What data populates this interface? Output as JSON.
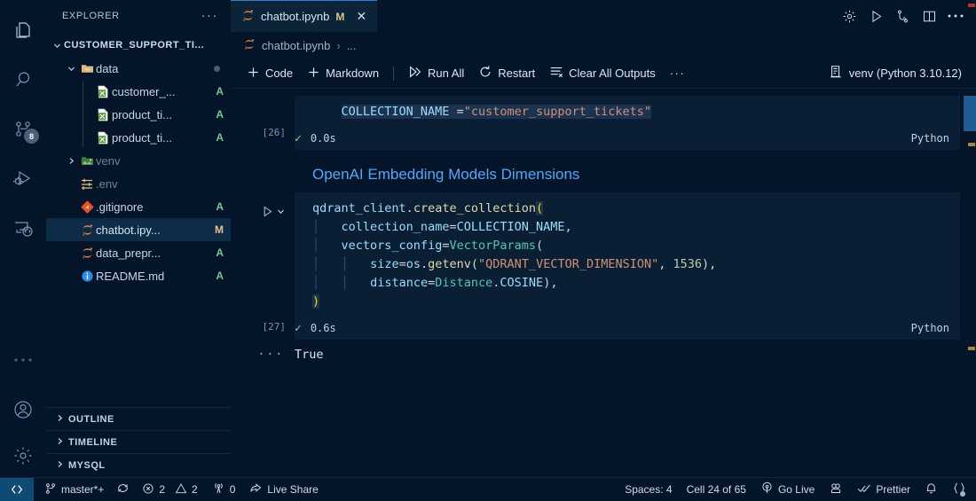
{
  "activitybar": {
    "items": [
      {
        "name": "explorer",
        "icon": "files-icon",
        "badge": null
      },
      {
        "name": "search",
        "icon": "search-icon",
        "badge": null
      },
      {
        "name": "source-control",
        "icon": "source-control-icon",
        "badge": "8"
      },
      {
        "name": "run-and-debug",
        "icon": "run-debug-icon",
        "badge": null
      },
      {
        "name": "remote-explorer",
        "icon": "remote-explorer-icon",
        "badge": null
      },
      {
        "name": "additional-views",
        "icon": "ellipsis-icon",
        "badge": null
      }
    ],
    "bottom": [
      {
        "name": "accounts",
        "icon": "account-icon"
      },
      {
        "name": "manage",
        "icon": "gear-icon"
      }
    ]
  },
  "sidebar": {
    "title": "EXPLORER",
    "more_label": "···",
    "root": "CUSTOMER_SUPPORT_TI...",
    "items": [
      {
        "label": "data",
        "icon": "folder-data-icon",
        "status": "",
        "indent": 1,
        "kind": "folder",
        "expanded": true,
        "modified_dot": true
      },
      {
        "label": "customer_...",
        "icon": "csv-file-icon",
        "status": "A",
        "indent": 2,
        "kind": "file"
      },
      {
        "label": "product_ti...",
        "icon": "csv-file-icon",
        "status": "A",
        "indent": 2,
        "kind": "file"
      },
      {
        "label": "product_ti...",
        "icon": "csv-file-icon",
        "status": "A",
        "indent": 2,
        "kind": "file"
      },
      {
        "label": "venv",
        "icon": "folder-venv-icon",
        "status": "",
        "indent": 1,
        "kind": "folder",
        "expanded": false,
        "dim": true
      },
      {
        "label": ".env",
        "icon": "env-file-icon",
        "status": "",
        "indent": 1,
        "kind": "file",
        "dim": true
      },
      {
        "label": ".gitignore",
        "icon": "git-file-icon",
        "status": "A",
        "indent": 1,
        "kind": "file"
      },
      {
        "label": "chatbot.ipy...",
        "icon": "jupyter-file-icon",
        "status": "M",
        "indent": 1,
        "kind": "file",
        "selected": true
      },
      {
        "label": "data_prepr...",
        "icon": "jupyter-file-icon",
        "status": "A",
        "indent": 1,
        "kind": "file"
      },
      {
        "label": "README.md",
        "icon": "info-file-icon",
        "status": "A",
        "indent": 1,
        "kind": "file"
      }
    ],
    "sections": [
      {
        "label": "OUTLINE"
      },
      {
        "label": "TIMELINE"
      },
      {
        "label": "MYSQL"
      }
    ]
  },
  "tabs": {
    "items": [
      {
        "label": "chatbot.ipynb",
        "icon": "jupyter-file-icon",
        "dirty_mark": "M",
        "close": "✕",
        "active": true
      }
    ],
    "actions": [
      {
        "name": "settings-gear-icon"
      },
      {
        "name": "run-icon"
      },
      {
        "name": "source-control-icon"
      },
      {
        "name": "split-editor-icon"
      },
      {
        "name": "more-actions-icon"
      }
    ]
  },
  "breadcrumb": {
    "file": "chatbot.ipynb",
    "separator": "›",
    "tail": "..."
  },
  "notebook_toolbar": {
    "add_code": "Code",
    "add_markdown": "Markdown",
    "run_all": "Run All",
    "restart": "Restart",
    "clear_all_outputs": "Clear All Outputs",
    "more": "···",
    "kernel": "venv (Python 3.10.12)"
  },
  "cells": [
    {
      "exec_count": "[26]",
      "lines": [
        [
          {
            "t": "    ",
            "c": "t-plain"
          },
          {
            "t": "COLLECTION_NAME",
            "c": "t-var sel-bg"
          },
          {
            "t": " ",
            "c": "t-plain sel-bg"
          },
          {
            "t": "=",
            "c": "t-op sel-bg"
          },
          {
            "t": "\"customer_support_tickets\"",
            "c": "t-str sel-bg"
          }
        ]
      ],
      "status": {
        "check": "✓",
        "time": "0.0s",
        "lang": "Python"
      }
    }
  ],
  "markdown_heading": "OpenAI Embedding Models Dimensions",
  "cell_toolbar": {
    "icons": [
      {
        "name": "run-by-line-icon"
      },
      {
        "name": "execute-above-cells-icon"
      },
      {
        "name": "execute-cell-and-below-icon"
      },
      {
        "name": "split-cell-icon"
      },
      {
        "name": "more-cell-actions-icon"
      },
      {
        "name": "delete-cell-icon"
      }
    ]
  },
  "active_cell": {
    "exec_count": "[27]",
    "lines": [
      [
        {
          "t": "qdrant_client",
          "c": "t-var"
        },
        {
          "t": ".",
          "c": "t-op"
        },
        {
          "t": "create_collection",
          "c": "t-fn"
        },
        {
          "t": "(",
          "c": "t-pun sel-bg"
        }
      ],
      [
        {
          "t": "    ",
          "c": "t-plain"
        },
        {
          "t": "collection_name",
          "c": "t-var"
        },
        {
          "t": "=",
          "c": "t-op"
        },
        {
          "t": "COLLECTION_NAME",
          "c": "t-var"
        },
        {
          "t": ",",
          "c": "t-op"
        }
      ],
      [
        {
          "t": "    ",
          "c": "t-plain"
        },
        {
          "t": "vectors_config",
          "c": "t-var"
        },
        {
          "t": "=",
          "c": "t-op"
        },
        {
          "t": "VectorParams",
          "c": "t-cls"
        },
        {
          "t": "(",
          "c": "t-op"
        }
      ],
      [
        {
          "t": "        ",
          "c": "t-plain"
        },
        {
          "t": "size",
          "c": "t-var"
        },
        {
          "t": "=",
          "c": "t-op"
        },
        {
          "t": "os",
          "c": "t-mod"
        },
        {
          "t": ".",
          "c": "t-op"
        },
        {
          "t": "getenv",
          "c": "t-fn"
        },
        {
          "t": "(",
          "c": "t-op"
        },
        {
          "t": "\"QDRANT_VECTOR_DIMENSION\"",
          "c": "t-str"
        },
        {
          "t": ", ",
          "c": "t-op"
        },
        {
          "t": "1536",
          "c": "t-num"
        },
        {
          "t": ")",
          "c": "t-op"
        },
        {
          "t": ",",
          "c": "t-op"
        }
      ],
      [
        {
          "t": "        ",
          "c": "t-plain"
        },
        {
          "t": "distance",
          "c": "t-var"
        },
        {
          "t": "=",
          "c": "t-op"
        },
        {
          "t": "Distance",
          "c": "t-cls"
        },
        {
          "t": ".",
          "c": "t-op"
        },
        {
          "t": "COSINE",
          "c": "t-var"
        },
        {
          "t": ")",
          "c": "t-op"
        },
        {
          "t": ",",
          "c": "t-op"
        }
      ],
      [
        {
          "t": ")",
          "c": "t-pun sel-bg"
        }
      ]
    ],
    "status": {
      "check": "✓",
      "time": "0.6s",
      "lang": "Python"
    },
    "output": {
      "dots": "···",
      "text": "True"
    }
  },
  "statusbar": {
    "remote_icon": "remote-window-icon",
    "left": [
      {
        "name": "branch",
        "icon": "source-control-icon",
        "label": "master*+"
      },
      {
        "name": "sync",
        "icon": "sync-icon",
        "label": ""
      },
      {
        "name": "problems-errors",
        "icon": "error-icon",
        "label": "2"
      },
      {
        "name": "problems-warnings",
        "icon": "warning-icon",
        "label": "2"
      },
      {
        "name": "ports",
        "icon": "radio-tower-icon",
        "label": "0"
      },
      {
        "name": "live-share",
        "icon": "live-share-icon",
        "label": "Live Share"
      }
    ],
    "right": [
      {
        "name": "indentation",
        "icon": "",
        "label": "Spaces: 4"
      },
      {
        "name": "cell-position",
        "icon": "",
        "label": "Cell 24 of 65"
      },
      {
        "name": "go-live",
        "icon": "broadcast-icon",
        "label": "Go Live"
      },
      {
        "name": "jupyter-variables",
        "icon": "jupyter-icon",
        "label": ""
      },
      {
        "name": "prettier",
        "icon": "checks-icon",
        "label": "Prettier"
      },
      {
        "name": "notifications",
        "icon": "bell-icon",
        "label": ""
      },
      {
        "name": "extension-status",
        "icon": "braces-icon",
        "label": ""
      }
    ]
  },
  "colors": {
    "background": "#041429",
    "accent": "#2a7fd4",
    "heading": "#4daafc",
    "added": "#73c991",
    "modified": "#e2c08d",
    "ok": "#89d185",
    "remote": "#0d4a74"
  }
}
